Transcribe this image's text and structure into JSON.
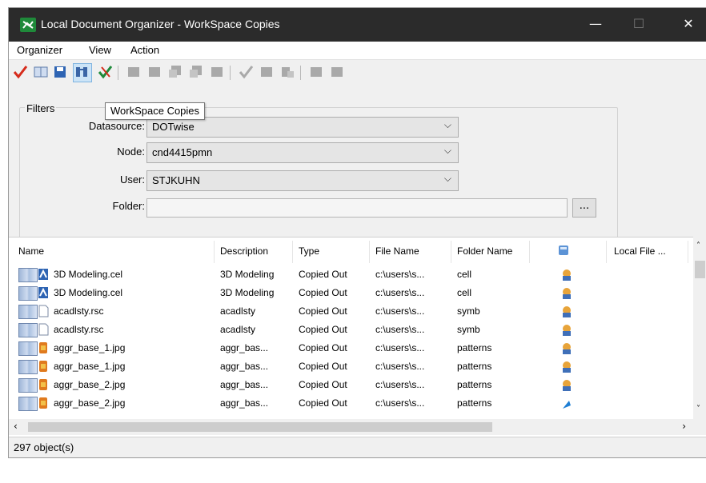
{
  "window": {
    "title": "Local Document Organizer - WorkSpace Copies",
    "controls": {
      "minimize": "—",
      "maximize": "☐",
      "close": "✕"
    }
  },
  "menu": [
    "Organizer",
    "View",
    "Action"
  ],
  "tooltip": "WorkSpace Copies",
  "filters": {
    "legend": "Filters",
    "datasource": {
      "label": "Datasource:",
      "value": "DOTwise"
    },
    "node": {
      "label": "Node:",
      "value": "cnd4415pmn"
    },
    "user": {
      "label": "User:",
      "value": "STJKUHN"
    },
    "folder": {
      "label": "Folder:",
      "value": "",
      "browse": "..."
    }
  },
  "columns": [
    "Name",
    "Description",
    "Type",
    "File Name",
    "Folder Name",
    "",
    "Local File ..."
  ],
  "rows": [
    {
      "name": "3D Modeling.cel",
      "description": "3D Modeling",
      "type": "Copied Out",
      "file": "c:\\users\\s...",
      "folder": "cell",
      "icon": "cel"
    },
    {
      "name": "3D Modeling.cel",
      "description": "3D Modeling",
      "type": "Copied Out",
      "file": "c:\\users\\s...",
      "folder": "cell",
      "icon": "cel"
    },
    {
      "name": "acadlsty.rsc",
      "description": "acadlsty",
      "type": "Copied Out",
      "file": "c:\\users\\s...",
      "folder": "symb",
      "icon": "doc"
    },
    {
      "name": "acadlsty.rsc",
      "description": "acadlsty",
      "type": "Copied Out",
      "file": "c:\\users\\s...",
      "folder": "symb",
      "icon": "doc"
    },
    {
      "name": "aggr_base_1.jpg",
      "description": "aggr_bas...",
      "type": "Copied Out",
      "file": "c:\\users\\s...",
      "folder": "patterns",
      "icon": "img"
    },
    {
      "name": "aggr_base_1.jpg",
      "description": "aggr_bas...",
      "type": "Copied Out",
      "file": "c:\\users\\s...",
      "folder": "patterns",
      "icon": "img"
    },
    {
      "name": "aggr_base_2.jpg",
      "description": "aggr_bas...",
      "type": "Copied Out",
      "file": "c:\\users\\s...",
      "folder": "patterns",
      "icon": "img"
    },
    {
      "name": "aggr_base_2.jpg",
      "description": "aggr_bas...",
      "type": "Copied Out",
      "file": "c:\\users\\s...",
      "folder": "patterns",
      "icon": "img"
    }
  ],
  "status": "297 object(s)",
  "colors": {
    "accent_check": "#d62b1b",
    "titlebar": "#2b2b2b",
    "app_icon": "#1f8a3a"
  }
}
